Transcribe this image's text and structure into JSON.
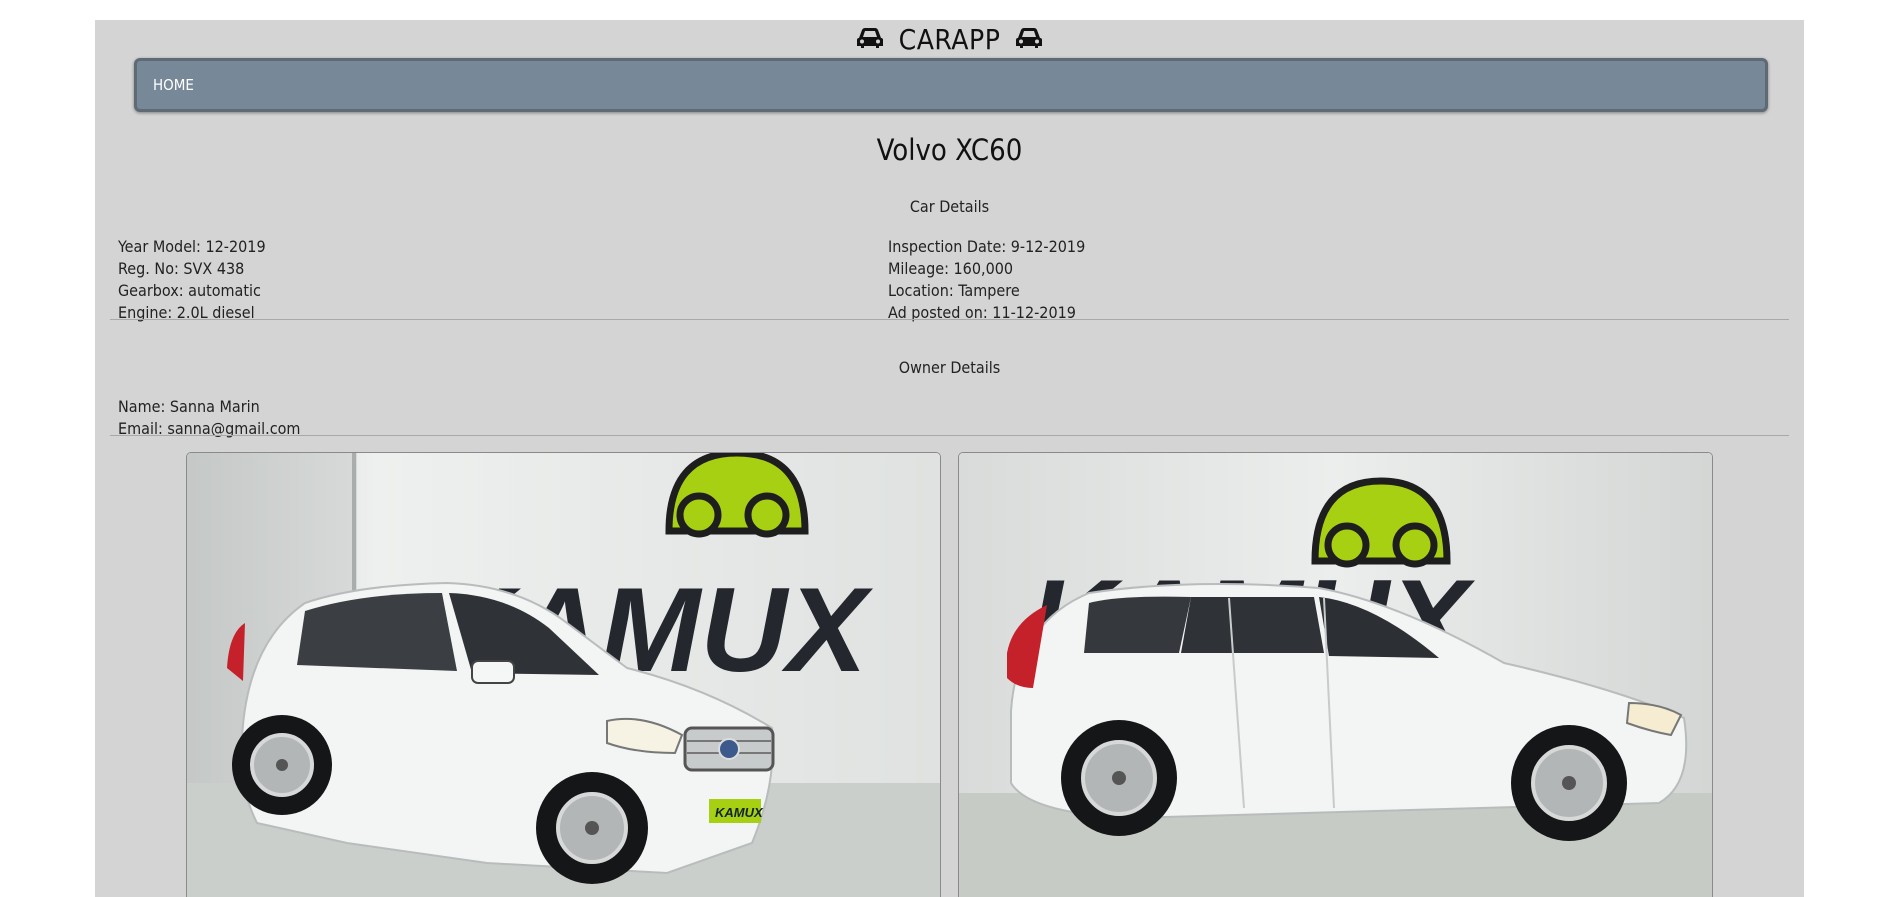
{
  "brand": {
    "title": "CARAPP",
    "left_icon": "car-icon",
    "right_icon": "car-icon"
  },
  "nav": {
    "items": [
      {
        "label": "HOME"
      }
    ]
  },
  "car": {
    "title": "Volvo XC60",
    "details_heading": "Car Details",
    "left_details": [
      "Year Model: 12-2019",
      "Reg. No: SVX 438",
      "Gearbox: automatic",
      "Engine: 2.0L diesel"
    ],
    "right_details": [
      "Inspection Date: 9-12-2019",
      "Mileage: 160,000",
      "Location: Tampere",
      "Ad posted on: 11-12-2019"
    ]
  },
  "owner": {
    "heading": "Owner Details",
    "lines": [
      "Name: Sanna Marin",
      "Email: sanna@gmail.com"
    ]
  },
  "photos": {
    "signage_text": "KAMUX",
    "plate_text": "KAMUX"
  },
  "colors": {
    "page_background": "#d4d4d4",
    "navbar": "#778899",
    "brand_logo_green": "#a8d012"
  }
}
